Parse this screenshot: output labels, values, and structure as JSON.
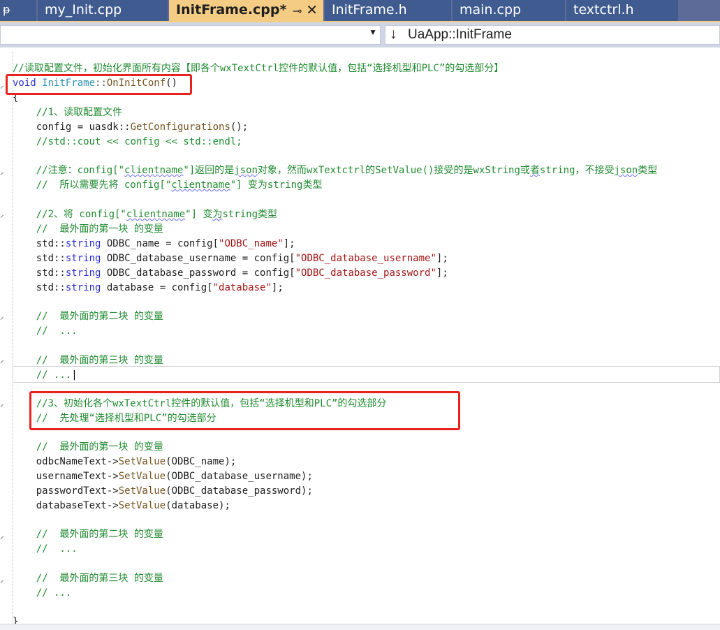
{
  "tabs": [
    {
      "label": "my_Init.cpp",
      "active": false
    },
    {
      "label": "InitFrame.cpp*",
      "active": true
    },
    {
      "label": "InitFrame.h",
      "active": false
    },
    {
      "label": "main.cpp",
      "active": false
    },
    {
      "label": "textctrl.h",
      "active": false
    }
  ],
  "tab_icons": {
    "pin": "ᵽ",
    "tab_pin": "⊸",
    "close": "✕"
  },
  "nav": {
    "left_value": "",
    "right_icon": "↓",
    "right_value": "UaApp::InitFrame"
  },
  "code": {
    "l1": "//读取配置文件，初始化界面所有内容【即各个wxTextCtrl控件的默认值，包括“选择机型和PLC”的勾选部分】",
    "l2_kw": "void",
    "l2_cls": "InitFrame",
    "l2_sep": "::",
    "l2_fn": "OnInitConf",
    "l2_paren": "()",
    "l3": "{",
    "l4": "    //1、读取配置文件",
    "l5_a": "    config = uasdk::",
    "l5_fn": "GetConfigurations",
    "l5_b": "();",
    "l6": "    //std::cout << config << std::endl;",
    "l8_a": "    //注意：config[\"",
    "l8_sq1": "clientname",
    "l8_b": "\"]返回的是",
    "l8_sq2": "json",
    "l8_c": "对象，然而wxTextctrl的SetValue()接受的是wxString或",
    "l8_sq3": "者",
    "l8_d": "string，不接受",
    "l8_sq4": "json",
    "l8_e": "类型",
    "l9_a": "    //  所以需要先将 config[\"",
    "l9_sq": "clientname",
    "l9_b": "\"] 变为string类型",
    "l11_a": "    //2、将 config[\"",
    "l11_sq": "clientname",
    "l11_b": "\"] 变",
    "l11_sq2": "为",
    "l11_c": "string类型",
    "l12": "    //  最外面的第一块 的变量",
    "l13_a": "    std::",
    "l13_t": "string",
    "l13_b": " ODBC_name = config[",
    "l13_s": "\"ODBC_name\"",
    "l13_c": "];",
    "l14_a": "    std::",
    "l14_t": "string",
    "l14_b": " ODBC_database_username = config[",
    "l14_s": "\"ODBC_database_username\"",
    "l14_c": "];",
    "l15_a": "    std::",
    "l15_t": "string",
    "l15_b": " ODBC_database_password = config[",
    "l15_s": "\"ODBC_database_password\"",
    "l15_c": "];",
    "l16_a": "    std::",
    "l16_t": "string",
    "l16_b": " database = config[",
    "l16_s": "\"database\"",
    "l16_c": "];",
    "l18": "    //  最外面的第二块 的变量",
    "l19": "    //  ...",
    "l21": "    //  最外面的第三块 的变量",
    "l22": "    // ...",
    "l24": "    //3、初始化各个wxTextCtrl控件的默认值，包括“选择机型和PLC”的勾选部分",
    "l25": "    //  先处理“选择机型和PLC”的勾选部分",
    "l27": "    //  最外面的第一块 的变量",
    "l28_a": "    odbcNameText->",
    "l28_fn": "SetValue",
    "l28_b": "(ODBC_name);",
    "l29_a": "    usernameText->",
    "l29_fn": "SetValue",
    "l29_b": "(ODBC_database_username);",
    "l30_a": "    passwordText->",
    "l30_fn": "SetValue",
    "l30_b": "(ODBC_database_password);",
    "l31_a": "    databaseText->",
    "l31_fn": "SetValue",
    "l31_b": "(database);",
    "l33": "    //  最外面的第二块 的变量",
    "l34": "    //  ...",
    "l36": "    //  最外面的第三块 的变量",
    "l37": "    // ...",
    "l39": "}"
  },
  "colors": {
    "tab_active": "#f5cc84",
    "tab_inactive": "#3f5b8f",
    "comment": "#1f8a2f",
    "keyword": "#2b2fd6",
    "string": "#a31515",
    "highlight_box": "#e8231d"
  }
}
